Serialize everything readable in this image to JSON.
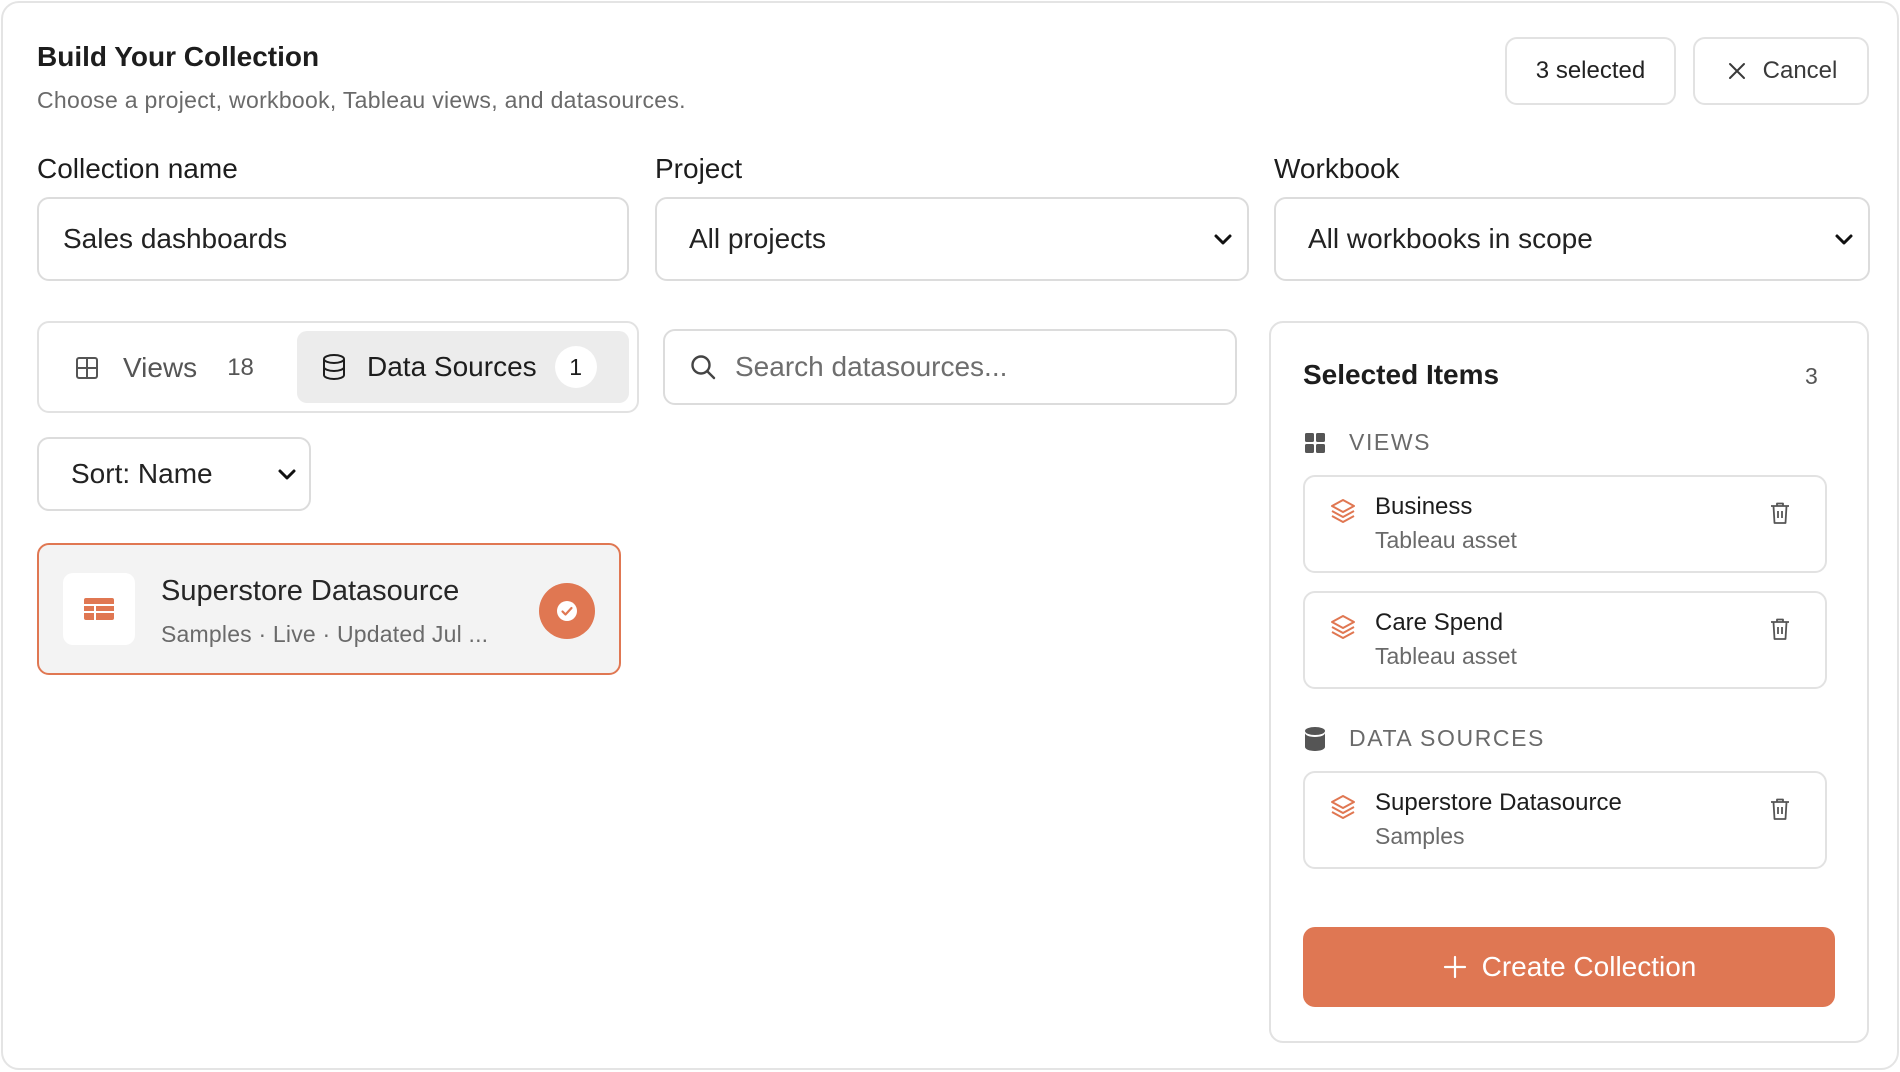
{
  "header": {
    "title": "Build Your Collection",
    "subtitle": "Choose a project, workbook, Tableau views, and datasources.",
    "selected_pill": "3 selected",
    "cancel_label": "Cancel"
  },
  "form": {
    "collection_name_label": "Collection name",
    "collection_name_value": "Sales dashboards",
    "project_label": "Project",
    "project_value": "All projects",
    "workbook_label": "Workbook",
    "workbook_value": "All workbooks in scope"
  },
  "tabs": [
    {
      "label": "Views",
      "count": "18",
      "icon": "grid-icon",
      "active": false
    },
    {
      "label": "Data Sources",
      "count": "1",
      "icon": "database-icon",
      "active": true
    }
  ],
  "search": {
    "placeholder": "Search datasources..."
  },
  "sort": {
    "value": "Sort: Name"
  },
  "datasources": [
    {
      "name": "Superstore Datasource",
      "meta": "Samples · Live · Updated Jul ...",
      "selected": true
    }
  ],
  "selected_panel": {
    "title": "Selected Items",
    "count": "3",
    "sections": [
      {
        "heading": "VIEWS",
        "icon": "grid-filled-icon",
        "items": [
          {
            "name": "Business",
            "sub": "Tableau asset"
          },
          {
            "name": "Care Spend",
            "sub": "Tableau asset"
          }
        ]
      },
      {
        "heading": "DATA SOURCES",
        "icon": "database-filled-icon",
        "items": [
          {
            "name": "Superstore Datasource",
            "sub": "Samples"
          }
        ]
      }
    ],
    "create_label": "Create Collection"
  },
  "colors": {
    "accent": "#df7753",
    "border": "#e2e2e2",
    "muted_text": "#6a6a6a"
  }
}
